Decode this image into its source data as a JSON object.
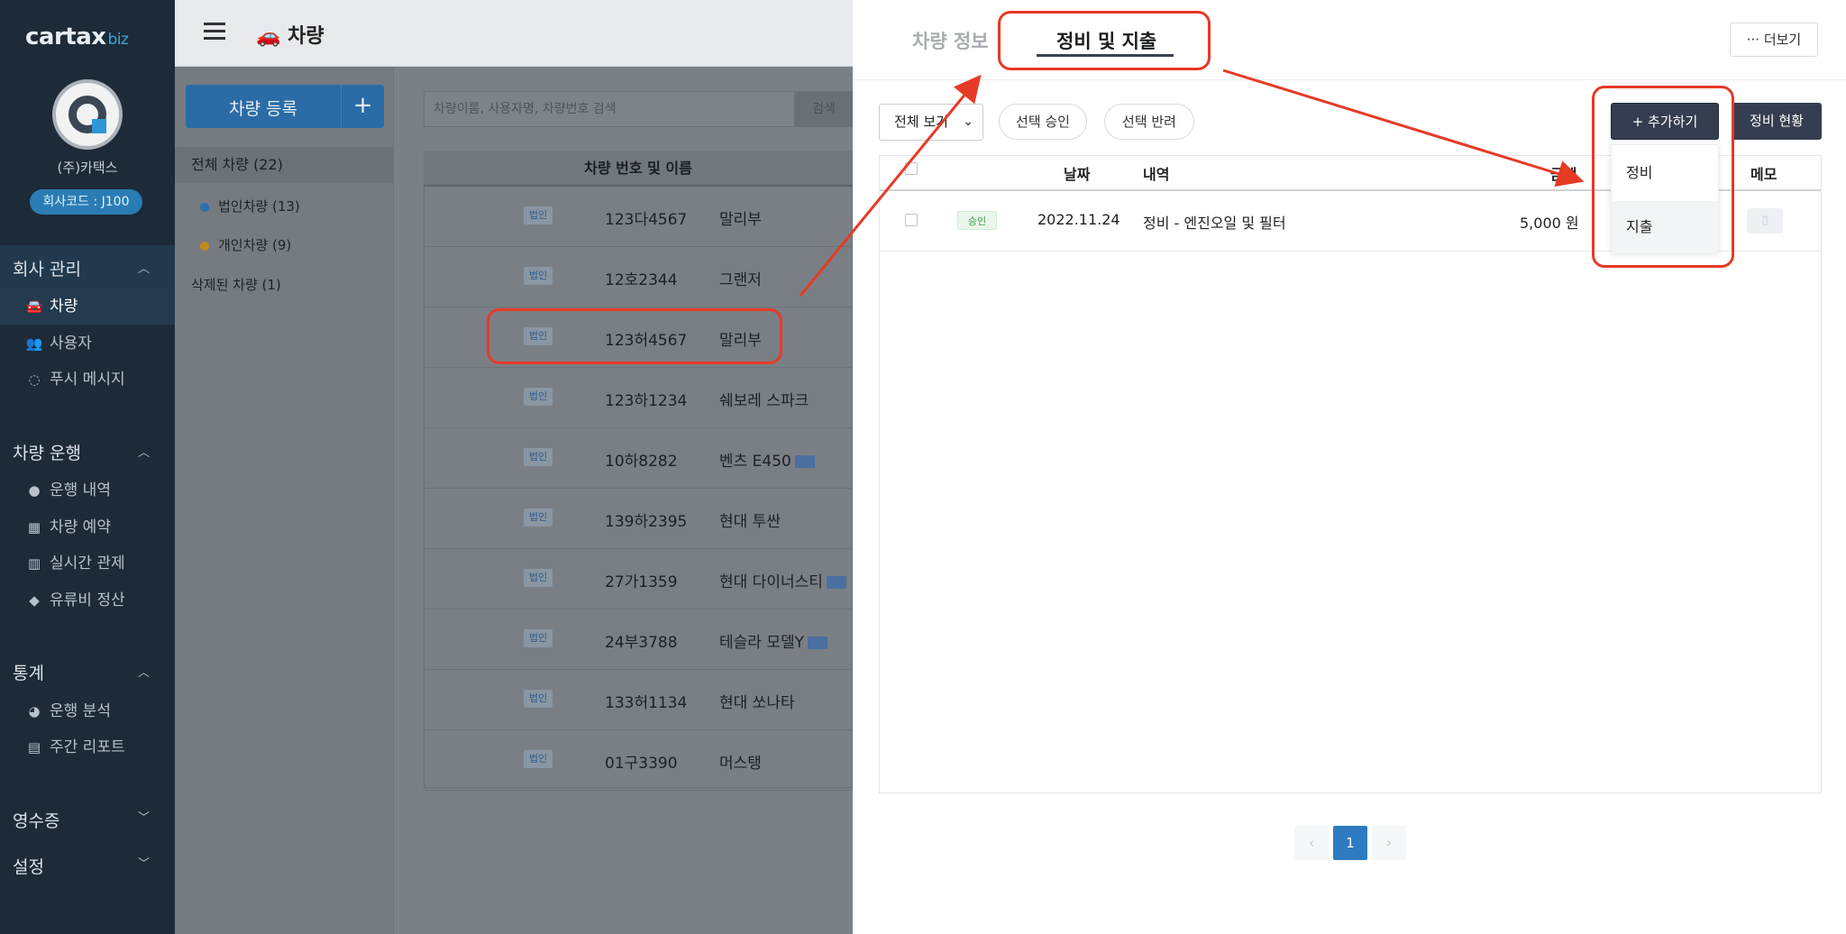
{
  "sidebar": {
    "logo_main": "cartax",
    "logo_suffix": "biz",
    "company_name": "(주)카택스",
    "company_code": "회사코드 : J100",
    "sections": {
      "company": {
        "title": "회사 관리",
        "items": [
          "차량",
          "사용자",
          "푸시 메시지"
        ]
      },
      "operation": {
        "title": "차량 운행",
        "items": [
          "운행 내역",
          "차량 예약",
          "실시간 관제",
          "유류비 정산"
        ]
      },
      "stats": {
        "title": "통계",
        "items": [
          "운행 분석",
          "주간 리포트"
        ]
      },
      "receipt": {
        "title": "영수증"
      },
      "settings": {
        "title": "설정"
      }
    }
  },
  "header": {
    "title": "차량"
  },
  "vehicle_panel": {
    "register_label": "차량 등록",
    "register_plus": "+",
    "filters": {
      "all": "전체 차량 (22)",
      "corporate": "법인차량 (13)",
      "personal": "개인차량 (9)",
      "deleted": "삭제된 차량 (1)"
    },
    "search_placeholder": "차량이름, 사용자명, 차량번호 검색",
    "search_button": "검색",
    "table_header": "차량 번호 및 이름",
    "rows": [
      {
        "badge": "법인",
        "plate": "123다4567",
        "name": "말리부",
        "tag": false
      },
      {
        "badge": "법인",
        "plate": "12호2344",
        "name": "그랜저",
        "tag": false
      },
      {
        "badge": "법인",
        "plate": "123허4567",
        "name": "말리부",
        "tag": false
      },
      {
        "badge": "법인",
        "plate": "123하1234",
        "name": "쉐보레 스파크",
        "tag": false
      },
      {
        "badge": "법인",
        "plate": "10하8282",
        "name": "벤츠 E450",
        "tag": true
      },
      {
        "badge": "법인",
        "plate": "139하2395",
        "name": "현대 투싼",
        "tag": false
      },
      {
        "badge": "법인",
        "plate": "27가1359",
        "name": "현대 다이너스티",
        "tag": true
      },
      {
        "badge": "법인",
        "plate": "24부3788",
        "name": "테슬라 모델Y",
        "tag": true
      },
      {
        "badge": "법인",
        "plate": "133허1134",
        "name": "현대 쏘나타",
        "tag": false
      },
      {
        "badge": "법인",
        "plate": "01구3390",
        "name": "머스탱",
        "tag": false
      }
    ]
  },
  "drawer": {
    "tabs": {
      "info": "차량 정보",
      "maintenance": "정비 및 지출"
    },
    "more_label": "··· 더보기",
    "view_select": "전체 보기",
    "approve_selected": "선택 승인",
    "reject_selected": "선택 반려",
    "add_label": "+ 추가하기",
    "status_label": "정비 현황",
    "dropdown": {
      "maintenance": "정비",
      "expense": "지출"
    },
    "columns": {
      "date": "날짜",
      "detail": "내역",
      "amount": "금액",
      "memo": "메모"
    },
    "rows": [
      {
        "status": "승인",
        "date": "2022.11.24",
        "detail": "정비 - 엔진오일 및 필터",
        "amount": "5,000 원"
      }
    ],
    "pagination": {
      "prev": "‹",
      "current": "1",
      "next": "›"
    }
  },
  "colors": {
    "sidebar_bg": "#1d2a38",
    "primary": "#2a6ca6",
    "dark_button": "#353d50",
    "annotation_red": "#e63a26"
  }
}
